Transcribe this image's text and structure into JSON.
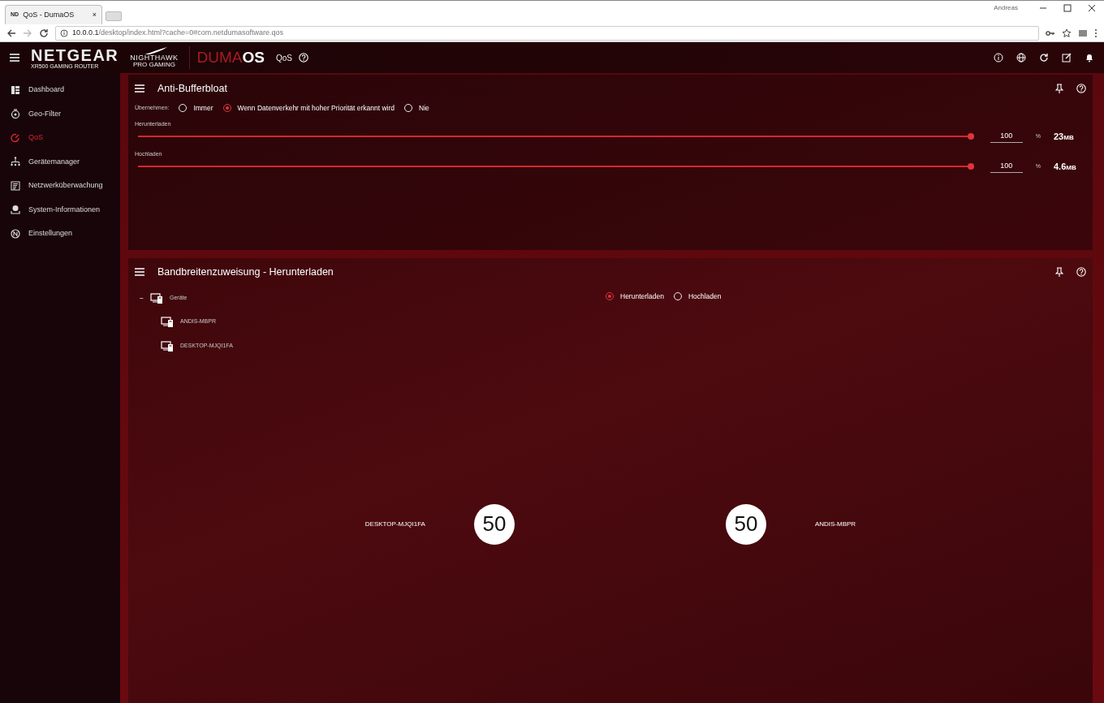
{
  "browser": {
    "tab_favicon": "ND",
    "tab_title": "QoS - DumaOS",
    "tab_close": "×",
    "user": "Andreas",
    "url_host": "10.0.0.1",
    "url_path": "/desktop/index.html?cache=0#com.netdumasoftware.qos"
  },
  "header": {
    "brand": "NETGEAR",
    "brand_sub": "XR500 GAMING ROUTER",
    "nighthawk": "NIGHTHAWK",
    "nighthawk_sub": "PRO GAMING",
    "duma": "DUMA",
    "os": "OS",
    "page": "QoS"
  },
  "sidebar": {
    "items": [
      {
        "label": "Dashboard",
        "kind": "dashboard",
        "selected": false
      },
      {
        "label": "Geo-Filter",
        "kind": "geo",
        "selected": false
      },
      {
        "label": "QoS",
        "kind": "qos",
        "selected": true
      },
      {
        "label": "Gerätemanager",
        "kind": "devices",
        "selected": false
      },
      {
        "label": "Netzwerküberwachung",
        "kind": "network",
        "selected": false
      },
      {
        "label": "System-Informationen",
        "kind": "info",
        "selected": false
      },
      {
        "label": "Einstellungen",
        "kind": "settings",
        "selected": false
      }
    ]
  },
  "anti_bufferbloat": {
    "title": "Anti-Bufferbloat",
    "apply_label": "Übernehmen:",
    "options": [
      {
        "label": "Immer",
        "selected": false
      },
      {
        "label": "Wenn Datenverkehr mit hoher Priorität erkannt wird",
        "selected": true
      },
      {
        "label": "Nie",
        "selected": false
      }
    ],
    "sliders": [
      {
        "label": "Herunterladen",
        "level": 1,
        "value": "100",
        "unit": "%",
        "amount": "23",
        "amount_unit": "MB"
      },
      {
        "label": "Hochladen",
        "level": 1,
        "value": "100",
        "unit": "%",
        "amount": "4.6",
        "amount_unit": "MB"
      }
    ]
  },
  "bandwidth": {
    "title": "Bandbreitenzuweisung - Herunterladen",
    "tree": {
      "toggle": "−",
      "label": "Geräte",
      "expanded": true,
      "children": [
        {
          "label": "ANDIS-MBPR"
        },
        {
          "label": "DESKTOP-MJQI1FA"
        }
      ]
    },
    "direction_options": [
      {
        "label": "Herunterladen",
        "selected": true
      },
      {
        "label": "Hochladen",
        "selected": false
      }
    ],
    "allocations": [
      {
        "device": "DESKTOP-MJQI1FA",
        "value": "50"
      },
      {
        "device": "ANDIS-MBPR",
        "value": "50"
      }
    ]
  }
}
